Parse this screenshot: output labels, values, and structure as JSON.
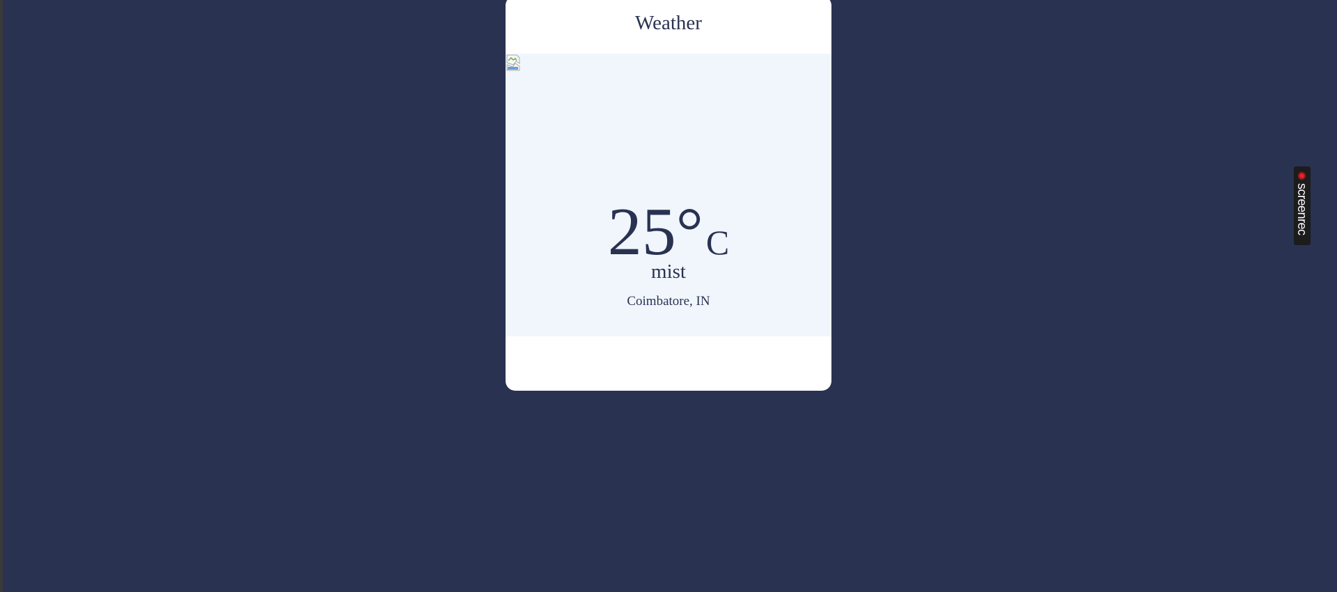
{
  "card": {
    "title": "Weather",
    "icon": "broken-image-icon",
    "temperature": "25°",
    "unit": "C",
    "condition": "mist",
    "location": "Coimbatore, IN"
  },
  "recorder_badge": {
    "label": "screenrec",
    "icon": "record-dot-icon"
  },
  "colors": {
    "background": "#293251",
    "card": "#ffffff",
    "panel": "#f1f6fd",
    "text": "#293251",
    "record": "#e8202a"
  }
}
